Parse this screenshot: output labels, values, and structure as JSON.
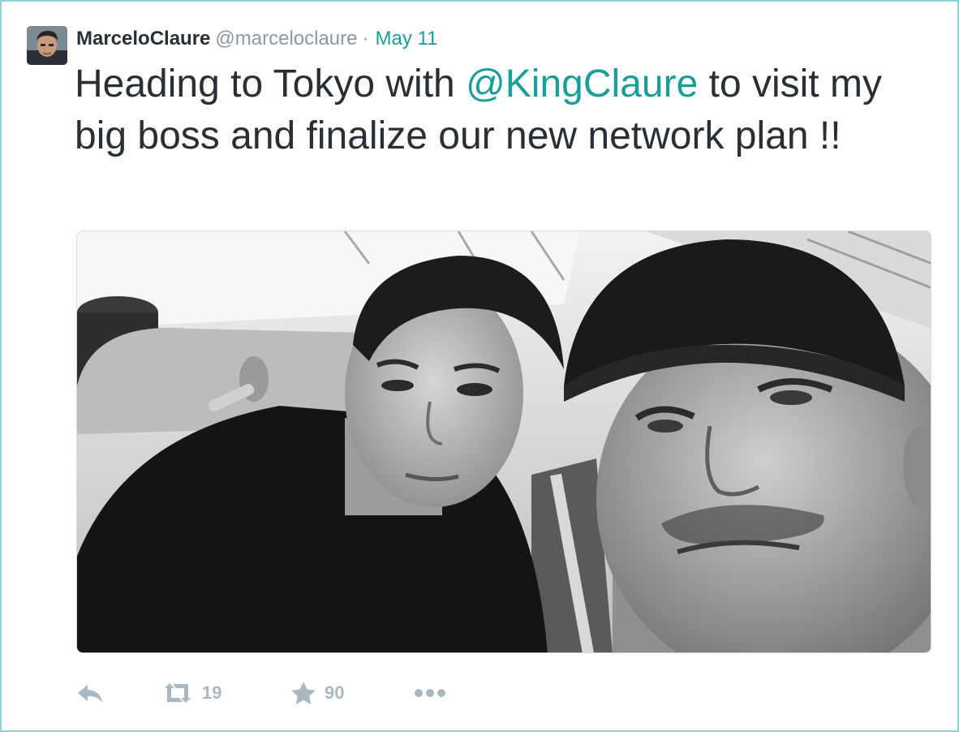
{
  "tweet": {
    "display_name": "MarceloClaure",
    "screen_name": "@marceloclaure",
    "separator": "·",
    "date": "May 11",
    "text_before": "Heading to Tokyo with ",
    "mention": "@KingClaure",
    "text_after": " to visit my big boss and finalize our new network plan !!"
  },
  "actions": {
    "reply_icon": "reply-icon",
    "retweet_icon": "retweet-icon",
    "retweet_count": "19",
    "favorite_icon": "star-icon",
    "favorite_count": "90",
    "more_icon": "more-dots-icon"
  },
  "colors": {
    "accent": "#1b9e98",
    "border": "#8fd3d1",
    "muted": "#aab8c2",
    "text": "#292f33"
  }
}
